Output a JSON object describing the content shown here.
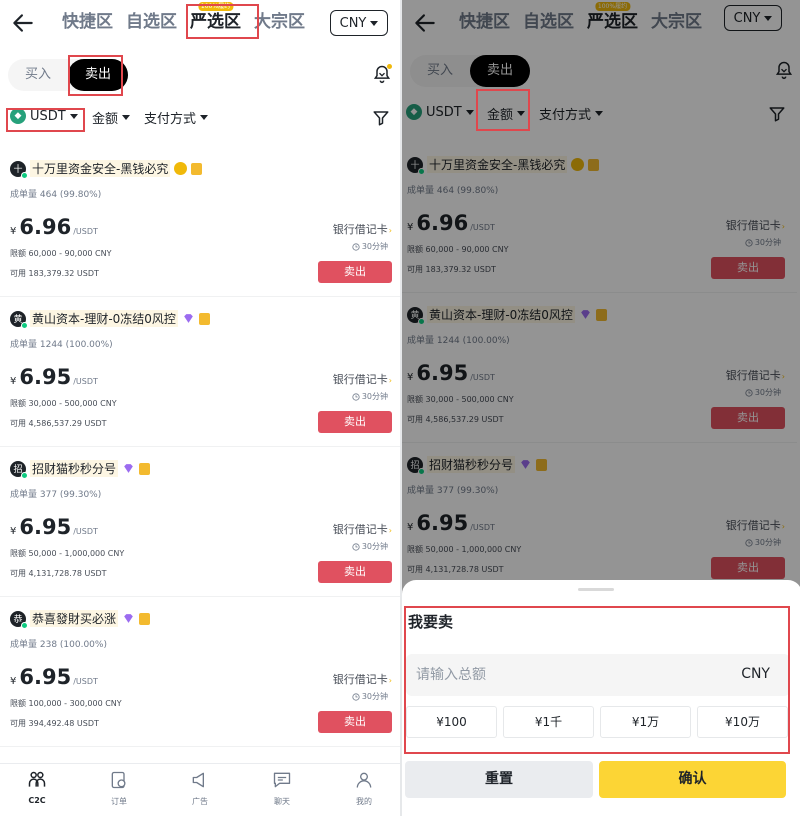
{
  "header": {
    "tabs": [
      {
        "label": "快捷区"
      },
      {
        "label": "自选区"
      },
      {
        "label": "严选区",
        "badge": "100%履约"
      },
      {
        "label": "大宗区"
      }
    ],
    "currency": "CNY"
  },
  "toggle": {
    "buy": "买入",
    "sell": "卖出"
  },
  "filters": {
    "asset": "USDT",
    "amount": "金额",
    "payment": "支付方式"
  },
  "listings": [
    {
      "avatar": "十",
      "name": "十万里资金安全-黑钱必究",
      "orders": "成单量 464 (99.80%)",
      "currency_symbol": "¥",
      "price": "6.96",
      "unit": "/USDT",
      "limit": "限额 60,000 - 90,000 CNY",
      "available": "可用 183,379.32 USDT",
      "payment": "银行借记卡",
      "time": "30分钟",
      "action": "卖出"
    },
    {
      "avatar": "黄",
      "name": "黄山资本-理财-0冻结0风控",
      "orders": "成单量 1244 (100.00%)",
      "currency_symbol": "¥",
      "price": "6.95",
      "unit": "/USDT",
      "limit": "限额 30,000 - 500,000 CNY",
      "available": "可用 4,586,537.29 USDT",
      "payment": "银行借记卡",
      "time": "30分钟",
      "action": "卖出"
    },
    {
      "avatar": "招",
      "name": "招财猫秒秒分号",
      "orders": "成单量 377 (99.30%)",
      "currency_symbol": "¥",
      "price": "6.95",
      "unit": "/USDT",
      "limit": "限额 50,000 - 1,000,000 CNY",
      "available": "可用 4,131,728.78 USDT",
      "payment": "银行借记卡",
      "time": "30分钟",
      "action": "卖出"
    },
    {
      "avatar": "恭",
      "name": "恭喜發財买必涨",
      "orders": "成单量 238 (100.00%)",
      "currency_symbol": "¥",
      "price": "6.95",
      "unit": "/USDT",
      "limit": "限额 100,000 - 300,000 CNY",
      "available": "可用 394,492.48 USDT",
      "payment": "银行借记卡",
      "time": "30分钟",
      "action": "卖出"
    }
  ],
  "tabbar": [
    {
      "label": "C2C"
    },
    {
      "label": "订单"
    },
    {
      "label": "广告"
    },
    {
      "label": "聊天"
    },
    {
      "label": "我的"
    }
  ],
  "sheet": {
    "title": "我要卖",
    "placeholder": "请输入总额",
    "unit": "CNY",
    "quick_amounts": [
      "¥100",
      "¥1千",
      "¥1万",
      "¥10万"
    ],
    "reset": "重置",
    "confirm": "确认"
  },
  "colors": {
    "sell": "#e05160",
    "accent": "#fcd535",
    "highlight": "#e0474d"
  }
}
